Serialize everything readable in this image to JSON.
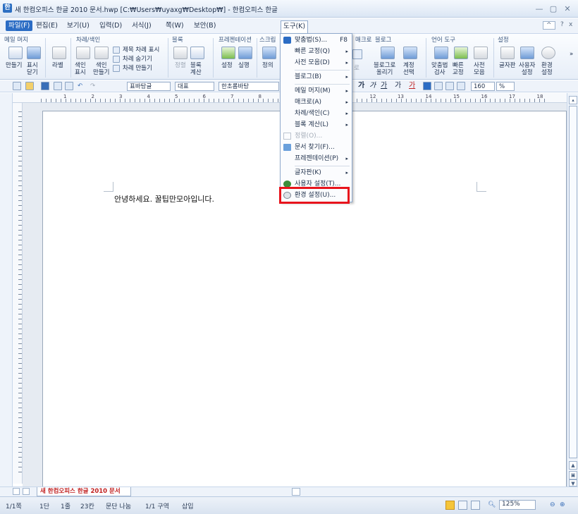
{
  "window": {
    "title": "새 한컴오피스 한글 2010 문서.hwp [C:₩Users₩uyaxg₩Desktop₩] - 한컴오피스 한글",
    "app_icon": "한"
  },
  "menubar": {
    "items": [
      "파일(F)",
      "편집(E)",
      "보기(U)",
      "입력(D)",
      "서식(J)",
      "쪽(W)",
      "보안(B)",
      "도구(K)"
    ],
    "open_menu": "도구(K)",
    "ribbon_toggle": "^",
    "help": "?",
    "close": "x"
  },
  "ribbon": {
    "groups": [
      "메일 머지",
      "차례/색인",
      "블록",
      "프레젠테이션",
      "스크립",
      "매크로",
      "블로그",
      "언어 도구",
      "설정"
    ],
    "mail_merge": {
      "make": "만들기",
      "show_close": "표시\n닫기",
      "label": "라벨"
    },
    "toc": {
      "index_display": "색인\n표시",
      "index_make": "색인\n만들기",
      "title_toc_display": "제목 차례 표시",
      "toc_hide": "차례 숨기기",
      "toc_make": "차례 만들기"
    },
    "block": {
      "sort": "정렬",
      "calc": "블록\n계산"
    },
    "presentation": {
      "setup": "설정",
      "run": "실행",
      "define": "정의"
    },
    "macro_partial": "로",
    "blog": {
      "upload": "블로그로\n올리기",
      "account": "계정\n선택"
    },
    "language": {
      "spell": "맞춤법\n검사",
      "quick": "빠른\n교정",
      "dict": "사전\n모음"
    },
    "settings": {
      "charmap": "글자판\n",
      "user": "사용자\n설정",
      "env": "환경\n설정"
    }
  },
  "toolbar": {
    "style": "표바탕글",
    "para": "대표",
    "font": "한초롬바탕",
    "format_btns": [
      "가",
      "가",
      "가",
      "가",
      "가"
    ],
    "zoom_field": "160",
    "zoom_unit": "%"
  },
  "ruler": {
    "numbers": [
      "1",
      "2",
      "3",
      "4",
      "5",
      "6",
      "7",
      "8",
      "9",
      "10",
      "11",
      "12",
      "13",
      "14",
      "15",
      "16",
      "17",
      "18"
    ]
  },
  "document": {
    "text": "안녕하세요. 꿀팁만모아입니다."
  },
  "dropdown": {
    "items": [
      {
        "label": "맞춤법(S)...",
        "shortcut": "F8",
        "icon": "spell-check-icon"
      },
      {
        "label": "빠른 교정(Q)",
        "submenu": true
      },
      {
        "label": "사전 모음(D)",
        "submenu": true
      },
      {
        "label": "블로그(B)",
        "submenu": true
      },
      {
        "label": "메일 머지(M)",
        "submenu": true
      },
      {
        "label": "매크로(A)",
        "submenu": true
      },
      {
        "label": "차례/색인(C)",
        "submenu": true
      },
      {
        "label": "블록 계산(L)",
        "submenu": true
      },
      {
        "label": "정렬(O)...",
        "disabled": true,
        "icon": "sort-icon"
      },
      {
        "label": "문서 찾기(F)...",
        "icon": "doc-find-icon"
      },
      {
        "label": "프레젠테이션(P)",
        "submenu": true
      },
      {
        "label": "글자판(K)",
        "submenu": true
      },
      {
        "label": "사용자 설정(T)...",
        "icon": "user-settings-icon"
      },
      {
        "label": "환경 설정(U)...",
        "icon": "gear-icon",
        "highlighted": true
      }
    ]
  },
  "tabbar": {
    "doc_tab": "새 한컴오피스 한글 2010 문서"
  },
  "status": {
    "page": "1/1쪽",
    "column": "1단",
    "line": "1줄",
    "char": "23칸",
    "split": "문단 나눔",
    "section": "1/1 구역",
    "mode": "삽입",
    "zoom": "125%",
    "zoom_out": "⊖",
    "zoom_in": "⊕"
  },
  "colors": {
    "accent": "#2b6cc4",
    "highlight_box": "#e8141c",
    "tab_text": "#c02020"
  }
}
